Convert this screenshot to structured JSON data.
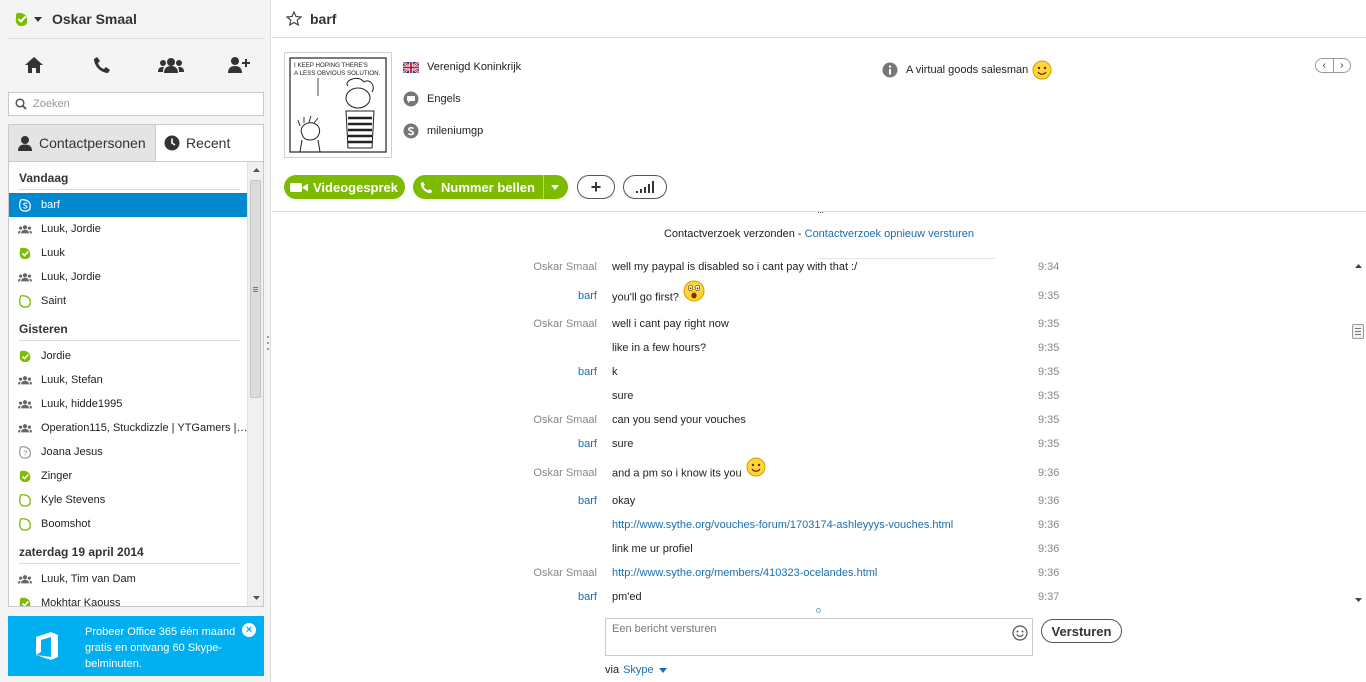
{
  "user": {
    "name": "Oskar Smaal"
  },
  "search": {
    "placeholder": "Zoeken"
  },
  "tabs": {
    "contacts": "Contactpersonen",
    "recent": "Recent"
  },
  "groups": [
    {
      "title": "Vandaag",
      "items": [
        {
          "label": "barf",
          "icon": "skype-status-icon",
          "selected": true
        },
        {
          "label": "Luuk, Jordie",
          "icon": "group-icon"
        },
        {
          "label": "Luuk",
          "icon": "online-status-icon"
        },
        {
          "label": "Luuk, Jordie",
          "icon": "group-icon"
        },
        {
          "label": "Saint",
          "icon": "offline-status-icon"
        }
      ]
    },
    {
      "title": "Gisteren",
      "items": [
        {
          "label": "Jordie",
          "icon": "online-status-icon"
        },
        {
          "label": "Luuk, Stefan",
          "icon": "group-icon"
        },
        {
          "label": "Luuk, hidde1995",
          "icon": "group-icon"
        },
        {
          "label": "Operation115, Stuckdizzle | YTGamers | ...",
          "icon": "group-icon"
        },
        {
          "label": "Joana Jesus",
          "icon": "unknown-status-icon"
        },
        {
          "label": "Zinger",
          "icon": "online-status-icon"
        },
        {
          "label": "Kyle Stevens",
          "icon": "offline-status-icon"
        },
        {
          "label": "Boomshot",
          "icon": "offline-status-icon"
        }
      ]
    },
    {
      "title": "zaterdag 19 april 2014",
      "items": [
        {
          "label": "Luuk, Tim van Dam",
          "icon": "group-icon"
        },
        {
          "label": "Mokhtar Kaouss",
          "icon": "online-status-icon"
        }
      ]
    }
  ],
  "promo": {
    "text": "Probeer Office 365 één maand gratis en ontvang 60 Skype-belminuten.",
    "close": "×"
  },
  "conversation": {
    "title": "barf",
    "profile": {
      "country": "Verenigd Koninkrijk",
      "language": "Engels",
      "skype_name": "mileniumgp",
      "mood": "A virtual goods salesman",
      "comic_caption_1": "I KEEP HOPING THERE'S",
      "comic_caption_2": "A LESS OBVIOUS SOLUTION."
    },
    "nav_prev": "‹",
    "nav_next": "›",
    "actions": {
      "video": "Videogesprek",
      "call": "Nummer bellen",
      "add": "+"
    },
    "collapse": "...",
    "contact_request": {
      "text": "Contactverzoek verzonden - ",
      "link": "Contactverzoek opnieuw versturen"
    },
    "messages": [
      {
        "sender": "Oskar Smaal",
        "from_me": true,
        "text": "well my paypal is disabled so i cant pay with that :/",
        "time": "9:34"
      },
      {
        "sender": "barf",
        "from_me": false,
        "text": "you'll go first?",
        "emoticon": "surprised",
        "time": "9:35"
      },
      {
        "sender": "Oskar Smaal",
        "from_me": true,
        "text": "well i cant pay right now",
        "time": "9:35"
      },
      {
        "sender": "",
        "from_me": true,
        "text": "like in a few hours?",
        "time": "9:35"
      },
      {
        "sender": "barf",
        "from_me": false,
        "text": "k",
        "time": "9:35"
      },
      {
        "sender": "",
        "from_me": false,
        "text": "sure",
        "time": "9:35"
      },
      {
        "sender": "Oskar Smaal",
        "from_me": true,
        "text": "can you send your vouches",
        "time": "9:35"
      },
      {
        "sender": "barf",
        "from_me": false,
        "text": "sure",
        "time": "9:35"
      },
      {
        "sender": "Oskar Smaal",
        "from_me": true,
        "text": "and a pm so i know its you",
        "emoticon": "smile",
        "time": "9:36"
      },
      {
        "sender": "barf",
        "from_me": false,
        "text": "okay",
        "time": "9:36"
      },
      {
        "sender": "",
        "from_me": false,
        "text": "http://www.sythe.org/vouches-forum/1703174-ashleyyys-vouches.html",
        "link": true,
        "time": "9:36"
      },
      {
        "sender": "",
        "from_me": false,
        "text": "link me ur profiel",
        "time": "9:36"
      },
      {
        "sender": "Oskar Smaal",
        "from_me": true,
        "text": "http://www.sythe.org/members/410323-ocelandes.html",
        "link": true,
        "time": "9:36"
      },
      {
        "sender": "barf",
        "from_me": false,
        "text": "pm'ed",
        "time": "9:37"
      }
    ],
    "composer": {
      "placeholder": "Een bericht versturen",
      "send": "Versturen",
      "via_label": "via",
      "via_link": "Skype"
    }
  },
  "colors": {
    "brand_blue": "#00aff0",
    "selection": "#0089cf",
    "online_green": "#7cbb00",
    "link": "#1a6fb0"
  }
}
